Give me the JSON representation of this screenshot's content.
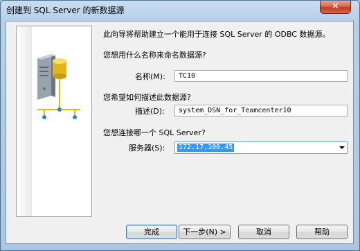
{
  "window": {
    "title": "创建到 SQL Server 的新数据源",
    "close_label": "✕"
  },
  "intro": "此向导将帮助建立一个能用于连接 SQL Server 的 ODBC 数据源。",
  "name_section": {
    "question": "您想用什么名称来命名数据源?",
    "label": "名称(M):",
    "value": "TC10"
  },
  "desc_section": {
    "question": "您希望如何描述此数据源?",
    "label": "描述(D):",
    "value": "system_DSN_for_Teamcenter10"
  },
  "server_section": {
    "question": "您想连接哪一个 SQL Server?",
    "label": "服务器(S):",
    "value": "172.17.100.45"
  },
  "buttons": {
    "finish": "完成",
    "next": "下一步(N) >",
    "cancel": "取消",
    "help": "帮助"
  },
  "art_icon": "database-server-icon"
}
